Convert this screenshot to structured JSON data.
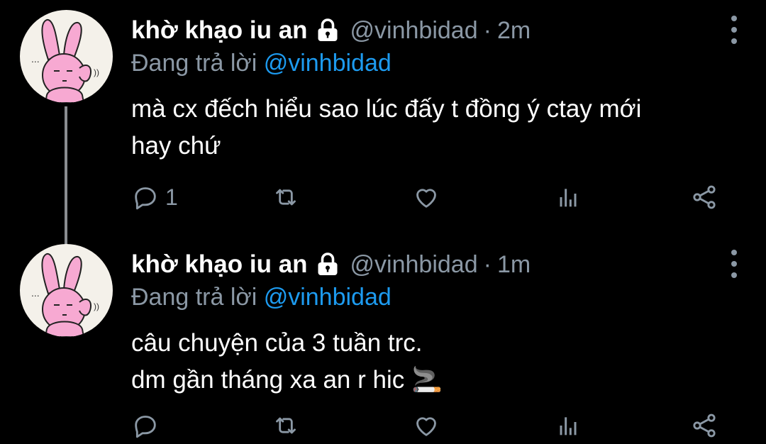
{
  "tweets": [
    {
      "author_name": "khờ khạo iu an",
      "handle": "@vinhbidad",
      "separator": "·",
      "time": "2m",
      "replying_prefix": "Đang trả lời ",
      "replying_to": "@vinhbidad",
      "text_lines": [
        "mà cx đếch hiểu sao lúc đấy t đồng ý ctay mới",
        "hay chứ"
      ],
      "reply_count": "1"
    },
    {
      "author_name": "khờ khạo iu an",
      "handle": "@vinhbidad",
      "separator": "·",
      "time": "1m",
      "replying_prefix": "Đang trả lời ",
      "replying_to": "@vinhbidad",
      "text_lines": [
        "câu chuyện của 3 tuần trc.",
        "dm gần tháng xa an r hic 🚬"
      ],
      "reply_count": ""
    }
  ],
  "icons": {
    "reply": "reply-icon",
    "retweet": "retweet-icon",
    "like": "heart-icon",
    "stats": "analytics-icon",
    "share": "share-icon",
    "lock": "lock-icon",
    "more": "more-vertical-icon"
  },
  "colors": {
    "background": "#000000",
    "primary_text": "#ffffff",
    "secondary_text": "#8b98a5",
    "mention": "#1d9bf0"
  }
}
